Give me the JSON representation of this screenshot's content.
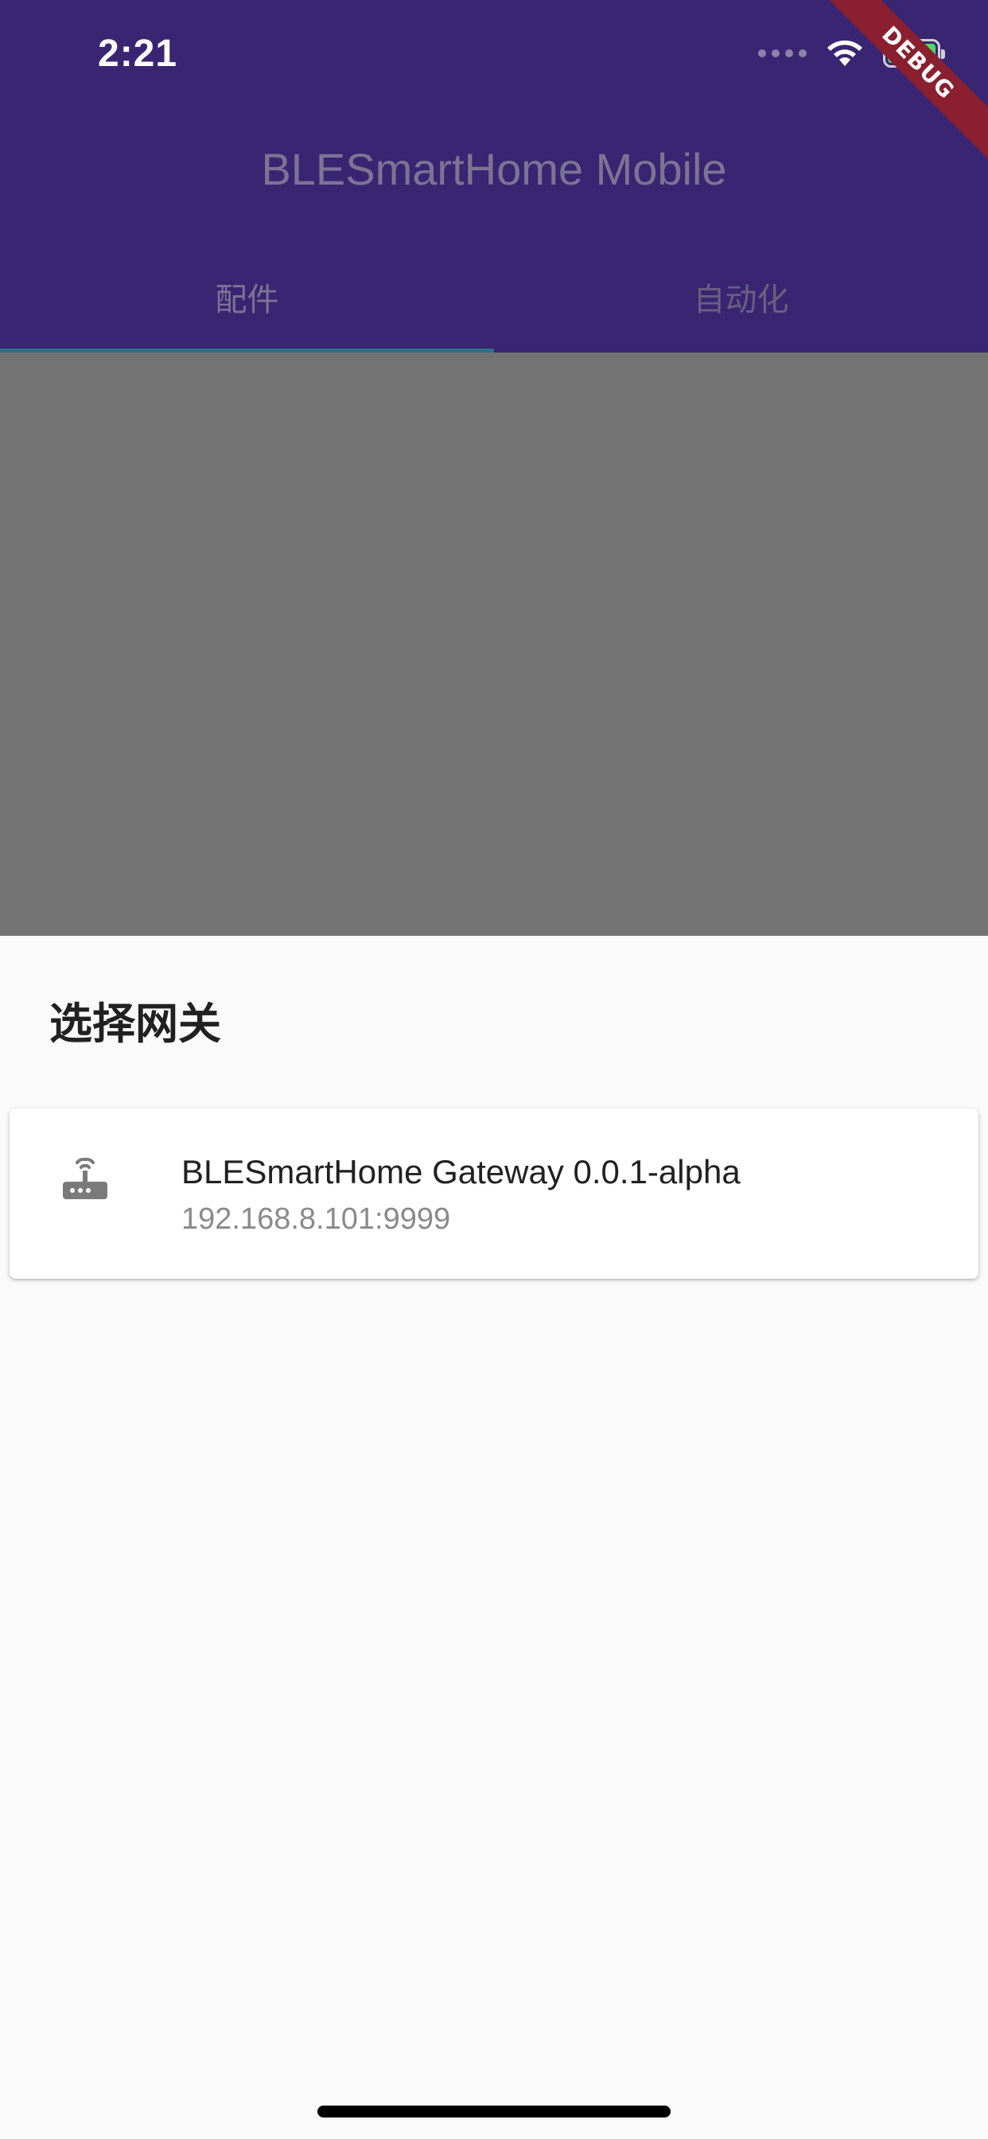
{
  "status_bar": {
    "time": "2:21",
    "icons": [
      "cellular-signal-icon",
      "wifi-icon",
      "battery-charging-icon"
    ]
  },
  "debug_banner": {
    "label": "DEBUG",
    "color": "#8a1f2f"
  },
  "app_bar": {
    "title": "BLESmartHome Mobile",
    "background_color": "#3a2573",
    "tabs": [
      {
        "label": "配件",
        "selected": true
      },
      {
        "label": "自动化",
        "selected": false
      }
    ]
  },
  "sheet": {
    "title": "选择网关",
    "gateways": [
      {
        "icon": "router-icon",
        "name": "BLESmartHome Gateway 0.0.1-alpha",
        "address": "192.168.8.101:9999"
      }
    ]
  }
}
